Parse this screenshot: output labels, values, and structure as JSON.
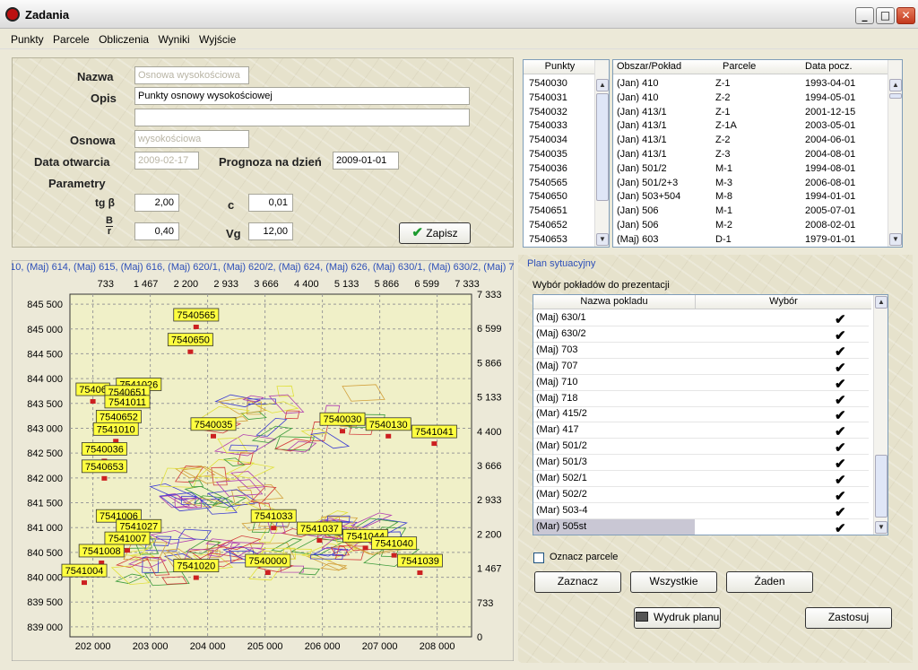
{
  "window": {
    "title": "Zadania",
    "buttons": [
      "_",
      "□",
      "✕"
    ]
  },
  "menu": [
    "Punkty",
    "Parcele",
    "Obliczenia",
    "Wyniki",
    "Wyjście"
  ],
  "form": {
    "nazwa_label": "Nazwa",
    "nazwa_value": "Osnowa wysokościowa",
    "opis_label": "Opis",
    "opis_value": "Punkty osnowy wysokościowej",
    "opis_value2": "",
    "osnowa_label": "Osnowa",
    "osnowa_value": "wysokościowa",
    "data_label": "Data otwarcia",
    "data_value": "2009-02-17",
    "prognoza_label": "Prognoza na dzień",
    "prognoza_value": "2009-01-01",
    "parametry_label": "Parametry",
    "tgb_label": "tg β",
    "tgb_value": "2,00",
    "c_label": "c",
    "c_value": "0,01",
    "br_label_top": "B",
    "br_label_bottom": "r",
    "br_value": "0,40",
    "vg_label": "Vg",
    "vg_value": "12,00",
    "save_label": "Zapisz"
  },
  "punkty": {
    "header": "Punkty",
    "items": [
      "7540030",
      "7540031",
      "7540032",
      "7540033",
      "7540034",
      "7540035",
      "7540036",
      "7540565",
      "7540650",
      "7540651",
      "7540652",
      "7540653"
    ]
  },
  "obszar": {
    "headers": [
      "Obszar/Pokład",
      "Parcele",
      "Data pocz."
    ],
    "rows": [
      [
        "(Jan) 410",
        "Z-1",
        "1993-04-01"
      ],
      [
        "(Jan) 410",
        "Z-2",
        "1994-05-01"
      ],
      [
        "(Jan) 413/1",
        "Z-1",
        "2001-12-15"
      ],
      [
        "(Jan) 413/1",
        "Z-1A",
        "2003-05-01"
      ],
      [
        "(Jan) 413/1",
        "Z-2",
        "2004-06-01"
      ],
      [
        "(Jan) 413/1",
        "Z-3",
        "2004-08-01"
      ],
      [
        "(Jan) 501/2",
        "M-1",
        "1994-08-01"
      ],
      [
        "(Jan) 501/2+3",
        "M-3",
        "2006-08-01"
      ],
      [
        "(Jan) 503+504",
        "M-8",
        "1994-01-01"
      ],
      [
        "(Jan) 506",
        "M-1",
        "2005-07-01"
      ],
      [
        "(Jan) 506",
        "M-2",
        "2008-02-01"
      ],
      [
        "(Maj) 603",
        "D-1",
        "1979-01-01"
      ]
    ]
  },
  "plan": {
    "group_title": "Plan sytuacyjny",
    "subtitle": "Wybór pokładów do prezentacji",
    "headers": [
      "Nazwa pokladu",
      "Wybór"
    ],
    "rows": [
      "(Maj) 630/1",
      "(Maj) 630/2",
      "(Maj) 703",
      "(Maj) 707",
      "(Maj) 710",
      "(Maj) 718",
      "(Mar) 415/2",
      "(Mar) 417",
      "(Mar) 501/2",
      "(Mar) 501/3",
      "(Mar) 502/1",
      "(Mar) 502/2",
      "(Mar) 503-4",
      "(Mar) 505st"
    ],
    "check_glyph": "✔",
    "oznacz_label": "Oznacz parcele",
    "zaznacz_label": "Zaznacz",
    "wszystkie_label": "Wszystkie",
    "zaden_label": "Żaden",
    "wydruk_label": "Wydruk planu",
    "zastosuj_label": "Zastosuj"
  },
  "chart_data": {
    "type": "scatter",
    "header_text": "610, (Maj) 614, (Maj) 615, (Maj) 616, (Maj) 620/1, (Maj) 620/2, (Maj) 624, (Maj) 626, (Maj) 630/1, (Maj) 630/2, (Maj) 70",
    "x_ticks": [
      "202 000",
      "203 000",
      "204 000",
      "205 000",
      "206 000",
      "207 000",
      "208 000"
    ],
    "y_ticks": [
      "839 000",
      "839 500",
      "840 000",
      "840 500",
      "841 000",
      "841 500",
      "842 000",
      "842 500",
      "843 000",
      "843 500",
      "844 000",
      "844 500",
      "845 000",
      "845 500"
    ],
    "top_ticks": [
      "733",
      "1 467",
      "2 200",
      "2 933",
      "3 666",
      "4 400",
      "5 133",
      "5 866",
      "6 599",
      "7 333"
    ],
    "right_ticks": [
      "0",
      "733",
      "1 467",
      "2 200",
      "2 933",
      "3 666",
      "4 400",
      "5 133",
      "5 866",
      "6 599",
      "7 333"
    ],
    "xlim": [
      201600,
      208600
    ],
    "ylim": [
      838800,
      845700
    ],
    "points": [
      {
        "label": "7540565",
        "x": 203800,
        "y": 845050
      },
      {
        "label": "7540650",
        "x": 203700,
        "y": 844550
      },
      {
        "label": "7541026",
        "x": 202800,
        "y": 843650
      },
      {
        "label": "75406",
        "x": 202000,
        "y": 843550
      },
      {
        "label": "7540651",
        "x": 202600,
        "y": 843500
      },
      {
        "label": "7541011",
        "x": 202600,
        "y": 843300
      },
      {
        "label": "7540652",
        "x": 202450,
        "y": 843000
      },
      {
        "label": "7541010",
        "x": 202400,
        "y": 842750
      },
      {
        "label": "7540036",
        "x": 202200,
        "y": 842350
      },
      {
        "label": "7540653",
        "x": 202200,
        "y": 842000
      },
      {
        "label": "7540035",
        "x": 204100,
        "y": 842850
      },
      {
        "label": "7540030",
        "x": 206350,
        "y": 842950
      },
      {
        "label": "7540130",
        "x": 207150,
        "y": 842850
      },
      {
        "label": "7541041",
        "x": 207950,
        "y": 842700
      },
      {
        "label": "7541006",
        "x": 202450,
        "y": 841000
      },
      {
        "label": "7541027",
        "x": 202800,
        "y": 840800
      },
      {
        "label": "7541007",
        "x": 202600,
        "y": 840550
      },
      {
        "label": "7541008",
        "x": 202150,
        "y": 840300
      },
      {
        "label": "7541004",
        "x": 201850,
        "y": 839900
      },
      {
        "label": "7541033",
        "x": 205150,
        "y": 841000
      },
      {
        "label": "7541037",
        "x": 205950,
        "y": 840750
      },
      {
        "label": "7541044",
        "x": 206750,
        "y": 840600
      },
      {
        "label": "7541040",
        "x": 207250,
        "y": 840450
      },
      {
        "label": "7541039",
        "x": 207700,
        "y": 840100
      },
      {
        "label": "7541020",
        "x": 203800,
        "y": 840000
      },
      {
        "label": "7540000",
        "x": 205050,
        "y": 840100
      }
    ]
  }
}
